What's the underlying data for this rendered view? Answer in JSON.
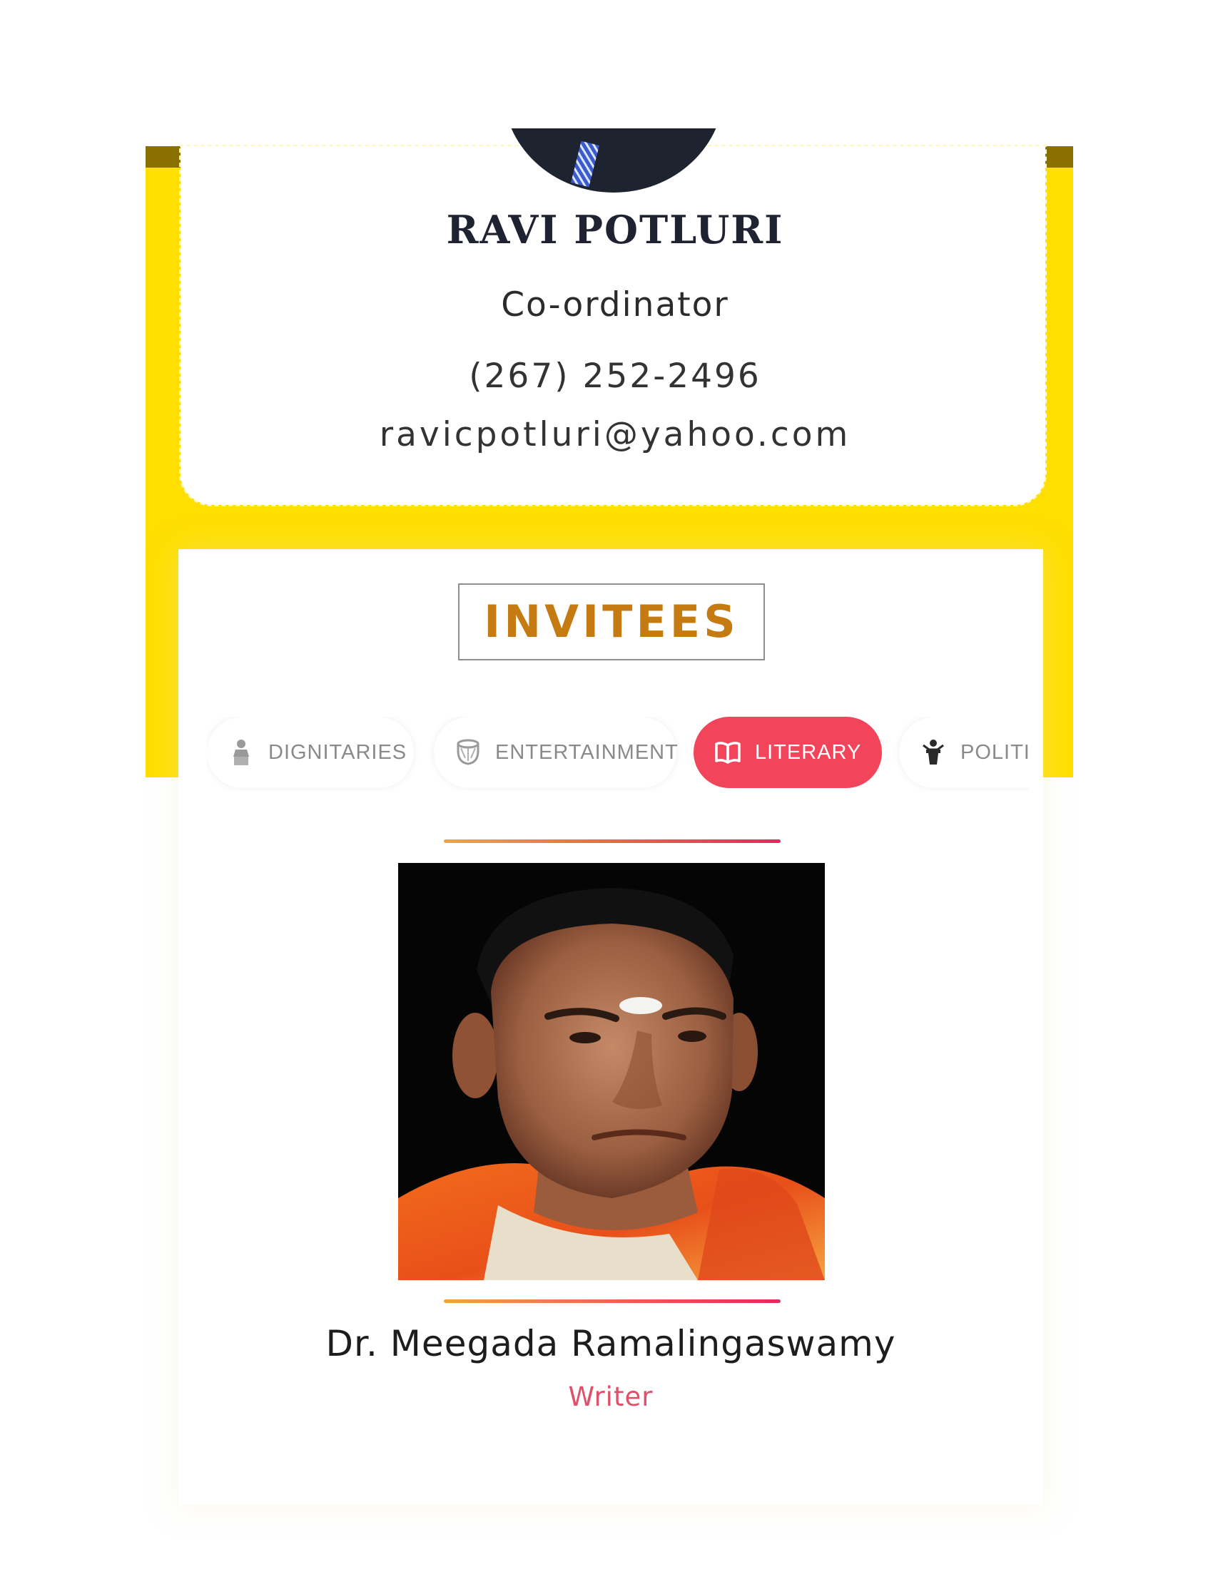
{
  "coordinator": {
    "name": "RAVI POTLURI",
    "role": "Co-ordinator",
    "phone": "(267) 252-2496",
    "email": "ravicpotluri@yahoo.com"
  },
  "invitees": {
    "heading": "INVITEES",
    "tabs": [
      {
        "label": "DIGNITARIES",
        "icon": "person-podium-icon",
        "active": false
      },
      {
        "label": "ENTERTAINMENT",
        "icon": "drum-icon",
        "active": false
      },
      {
        "label": "LITERARY",
        "icon": "open-book-icon",
        "active": true
      },
      {
        "label": "POLITI",
        "icon": "speaker-podium-icon",
        "active": false
      }
    ],
    "selected_invitee": {
      "name": "Dr. Meegada Ramalingaswamy",
      "role": "Writer"
    }
  },
  "colors": {
    "frame_yellow": "#fedf00",
    "heading_gold": "#c57b12",
    "active_tab": "#f2455b",
    "role_pink": "#e0506a",
    "gradient_start": "#f6a23c",
    "gradient_end": "#e22a5e"
  }
}
